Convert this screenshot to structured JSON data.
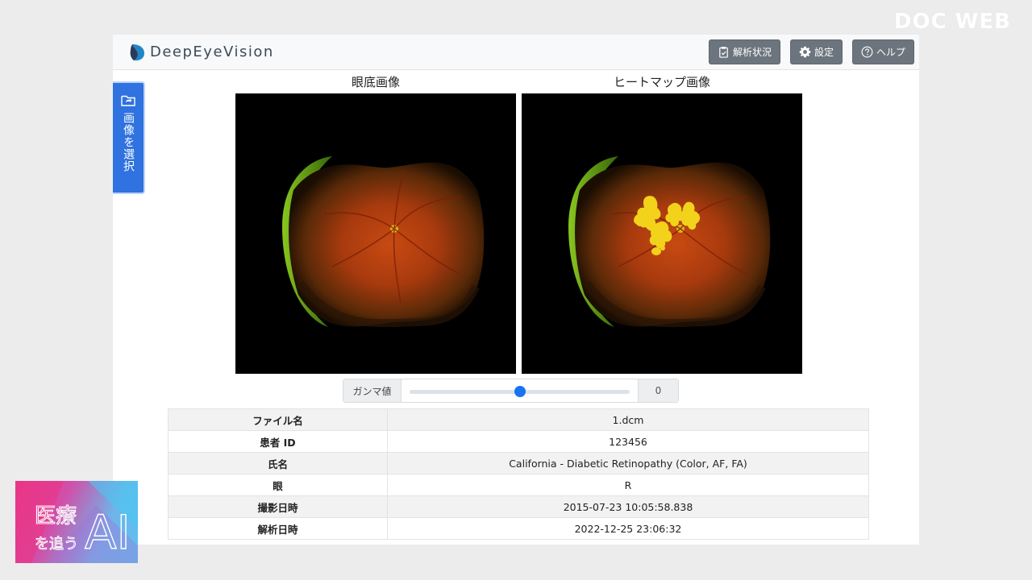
{
  "watermark": "DOC WEB",
  "brand": {
    "name": "DeepEyeVision"
  },
  "nav": {
    "analysis_status": "解析状況",
    "settings": "設定",
    "help": "ヘルプ"
  },
  "side_tab": {
    "label": "画像を選択"
  },
  "images": {
    "fundus_title": "眼底画像",
    "heatmap_title": "ヒートマップ画像"
  },
  "gamma": {
    "label": "ガンマ値",
    "value": "0",
    "slider_fraction": 0.5
  },
  "info": {
    "rows": [
      {
        "key": "ファイル名",
        "value": "1.dcm"
      },
      {
        "key": "患者 ID",
        "value": "123456"
      },
      {
        "key": "氏名",
        "value": "California - Diabetic Retinopathy (Color, AF, FA)"
      },
      {
        "key": "眼",
        "value": "R"
      },
      {
        "key": "撮影日時",
        "value": "2015-07-23 10:05:58.838"
      },
      {
        "key": "解析日時",
        "value": "2022-12-25 23:06:32"
      }
    ]
  },
  "badge": {
    "line1": "医療",
    "line2": "を追う",
    "ai": "AI"
  },
  "colors": {
    "primary": "#2f72e0",
    "secondary_btn": "#6c757d",
    "heatmap": "#f2d21a",
    "slider": "#1a73f0"
  }
}
